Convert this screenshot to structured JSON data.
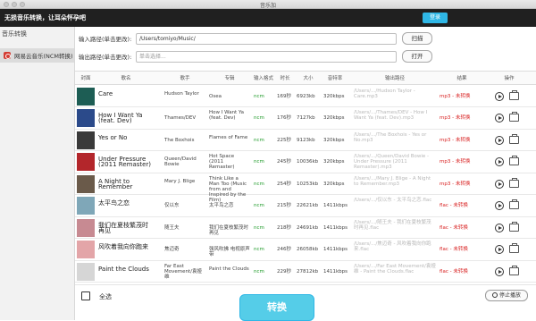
{
  "window": {
    "title": "音乐加"
  },
  "banner": {
    "text": "无损音乐转换，让耳朵怀孕吧",
    "login_label": "登录"
  },
  "sidebar": {
    "header": "音乐转换",
    "items": [
      {
        "label": "网易云音乐(NCM转换)"
      }
    ]
  },
  "form": {
    "input_label": "输入路径(单击更改):",
    "input_value": "/Users/tomiyo/Music/",
    "scan_label": "扫描",
    "output_label": "输出路径(单击更改):",
    "output_placeholder": "单击选择...",
    "open_label": "打开"
  },
  "table": {
    "headers": [
      "封面",
      "歌名",
      "歌手",
      "专辑",
      "输入格式",
      "时长",
      "大小",
      "音特率",
      "输出路径",
      "结果",
      "操作"
    ],
    "rows": [
      {
        "title": "Care",
        "artist": "Hudson Taylor",
        "album": "Osea",
        "format": "ncm",
        "duration": "169秒",
        "size": "6923kb",
        "bitrate": "320kbps",
        "output": "/Users/.../Hudson Taylor - Care.mp3",
        "result": "mp3 - 未转换",
        "cover_color": "#1d5d54"
      },
      {
        "title": "How I Want Ya (feat. Dev)",
        "artist": "Thames/DEV",
        "album": "How I Want Ya (feat. Dev)",
        "format": "ncm",
        "duration": "176秒",
        "size": "7127kb",
        "bitrate": "320kbps",
        "output": "/Users/.../Thames/DEV - How I Want Ya (feat. Dev).mp3",
        "result": "mp3 - 未转换",
        "cover_color": "#2b4a8a"
      },
      {
        "title": "Yes or No",
        "artist": "The Boxhois",
        "album": "Flames of Fame",
        "format": "ncm",
        "duration": "225秒",
        "size": "9123kb",
        "bitrate": "320kbps",
        "output": "/Users/.../The Boxhois - Yes or No.mp3",
        "result": "mp3 - 未转换",
        "cover_color": "#3a3a3a"
      },
      {
        "title": "Under Pressure (2011 Remaster)",
        "artist": "Queen/David Bowie",
        "album": "Hot Space (2011 Remaster)",
        "format": "ncm",
        "duration": "245秒",
        "size": "10036kb",
        "bitrate": "320kbps",
        "output": "/Users/.../Queen/David Bowie - Under Pressure (2011 Remaster).mp3",
        "result": "mp3 - 未转换",
        "cover_color": "#b3262b"
      },
      {
        "title": "A Night to Remember",
        "artist": "Mary J. Blige",
        "album": "Think Like a Man Too (Music from and Inspired by the Film)",
        "format": "ncm",
        "duration": "254秒",
        "size": "10253kb",
        "bitrate": "320kbps",
        "output": "/Users/.../Mary J. Blige - A Night to Remember.mp3",
        "result": "mp3 - 未转换",
        "cover_color": "#6a5a4a"
      },
      {
        "title": "太平鸟之恋",
        "artist": "仅以东",
        "album": "太平鸟之恋",
        "format": "ncm",
        "duration": "215秒",
        "size": "22621kb",
        "bitrate": "1411kbps",
        "output": "/Users/.../仅以东 - 太平鸟之恋.flac",
        "result": "flac - 未转换",
        "cover_color": "#7fa7b8"
      },
      {
        "title": "我们在夏枝繁茂时再见",
        "artist": "随王夫",
        "album": "我们在夏枝繁茂时再见",
        "format": "ncm",
        "duration": "218秒",
        "size": "24691kb",
        "bitrate": "1411kbps",
        "output": "/Users/.../随王夫 - 我们在夏枝繁茂时再见.flac",
        "result": "flac - 未转换",
        "cover_color": "#c78a92"
      },
      {
        "title": "风吹着我向你跑来",
        "artist": "焦迈奇",
        "album": "强风吹拂 电视原声带",
        "format": "ncm",
        "duration": "246秒",
        "size": "26058kb",
        "bitrate": "1411kbps",
        "output": "/Users/.../焦迈奇 - 风吹着我向你跑来.flac",
        "result": "flac - 未转换",
        "cover_color": "#e3a5a8"
      },
      {
        "title": "Paint the Clouds",
        "artist": "Far East Movement/袁娅维",
        "album": "Paint the Clouds",
        "format": "ncm",
        "duration": "229秒",
        "size": "27812kb",
        "bitrate": "1411kbps",
        "output": "/Users/.../Far East Movement/袁娅维 - Paint the Clouds.flac",
        "result": "flac - 未转换",
        "cover_color": "#d6d6d6"
      }
    ]
  },
  "bottom": {
    "select_all": "全选",
    "convert_label": "转换",
    "stop_label": "停止播放"
  },
  "colors": {
    "accent": "#2fb7e6",
    "result_red": "#d81e1e",
    "format_green": "#1e9a28"
  }
}
